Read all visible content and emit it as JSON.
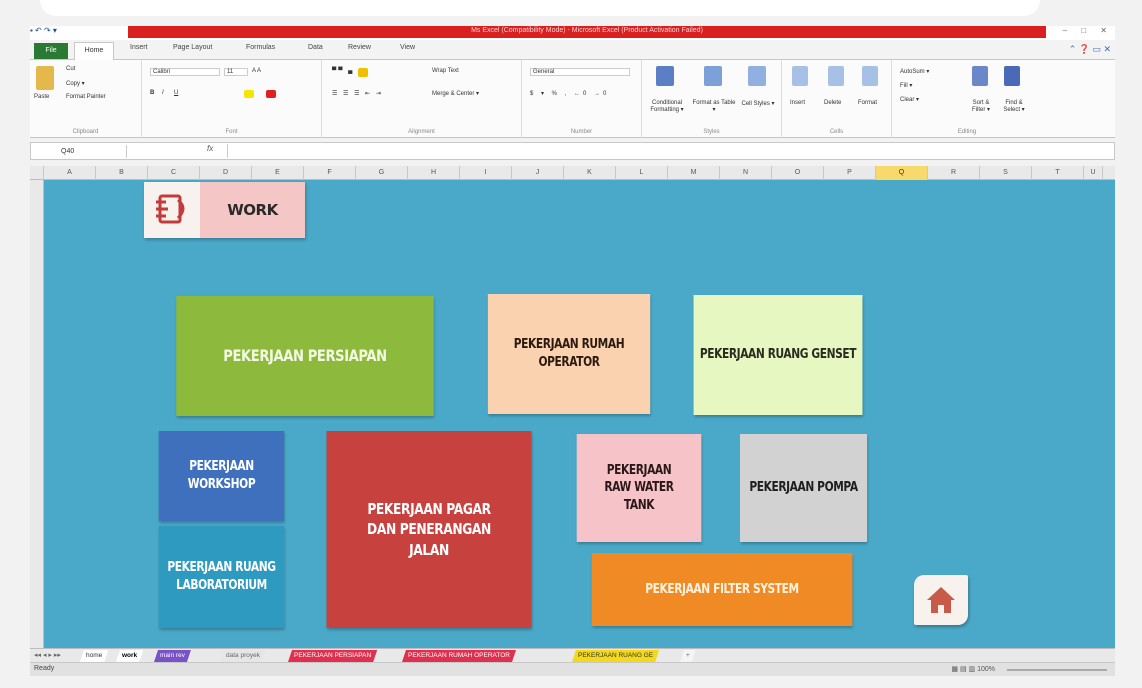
{
  "window": {
    "title": "Ms Excel (Compatibility Mode) - Microsoft Excel (Product Activation Failed)",
    "quick_access": "▪ ↶ ↷ ▾",
    "window_buttons": "– □ ✕"
  },
  "ribbon_tabs": {
    "file": "File",
    "home": "Home",
    "items": [
      "Insert",
      "Page Layout",
      "Formulas",
      "Data",
      "Review",
      "View"
    ]
  },
  "ribbon": {
    "clipboard": {
      "paste": "Paste",
      "cut": "Cut",
      "copy": "Copy ▾",
      "format_painter": "Format Painter",
      "label": "Clipboard"
    },
    "font": {
      "name": "Calibri",
      "size": "11",
      "label": "Font"
    },
    "alignment": {
      "wrap": "Wrap Text",
      "merge": "Merge & Center ▾",
      "label": "Alignment"
    },
    "number": {
      "format": "General",
      "label": "Number"
    },
    "styles": {
      "conditional": "Conditional Formatting ▾",
      "format_table": "Format as Table ▾",
      "cell_styles": "Cell Styles ▾",
      "label": "Styles"
    },
    "cells": {
      "insert": "Insert",
      "delete": "Delete",
      "format": "Format",
      "label": "Cells"
    },
    "editing": {
      "autosum": "AutoSum ▾",
      "fill": "Fill ▾",
      "clear": "Clear ▾",
      "sort": "Sort & Filter ▾",
      "find": "Find & Select ▾",
      "label": "Editing"
    }
  },
  "formula_bar": {
    "name_box": "Q40",
    "fx": "fx",
    "value": ""
  },
  "columns": [
    "A",
    "B",
    "C",
    "D",
    "E",
    "F",
    "G",
    "H",
    "I",
    "J",
    "K",
    "L",
    "M",
    "N",
    "O",
    "P",
    "Q",
    "R",
    "S",
    "T",
    "U"
  ],
  "selected_column": "Q",
  "header_tile": {
    "label": "WORK",
    "icon": "work-document-icon"
  },
  "tiles": [
    {
      "id": "persiapan",
      "label": "PEKERJAAN PERSIAPAN",
      "bg": "#8dba3c",
      "fg": "#f4f9e4"
    },
    {
      "id": "rumah-operator",
      "label": "PEKERJAAN RUMAH OPERATOR",
      "bg": "#fbd2b0",
      "fg": "#2a1a10"
    },
    {
      "id": "ruang-genset",
      "label": "PEKERJAAN RUANG GENSET",
      "bg": "#e6f7c2",
      "fg": "#2a2a20"
    },
    {
      "id": "workshop",
      "label": "PEKERJAAN WORKSHOP",
      "bg": "#3e70bd",
      "fg": "#ffffff"
    },
    {
      "id": "pagar",
      "label": "PEKERJAAN PAGAR DAN PENERANGAN JALAN",
      "bg": "#c7413e",
      "fg": "#ffffff"
    },
    {
      "id": "raw-water",
      "label": "PEKERJAAN RAW WATER TANK",
      "bg": "#f6c4c8",
      "fg": "#2a1818"
    },
    {
      "id": "pompa",
      "label": "PEKERJAAN POMPA",
      "bg": "#d2d2d2",
      "fg": "#1e1e1e"
    },
    {
      "id": "laboratorium",
      "label": "PEKERJAAN RUANG LABORATORIUM",
      "bg": "#2f9ac0",
      "fg": "#ffffff"
    },
    {
      "id": "filter",
      "label": "PEKERJAAN FILTER SYSTEM",
      "bg": "#f08a24",
      "fg": "#fff3e0"
    }
  ],
  "home_button": {
    "icon": "home-icon"
  },
  "sheet_tabs": [
    {
      "label": "home",
      "bg": "#ffffff",
      "fg": "#333333"
    },
    {
      "label": "work",
      "bg": "#ffffff",
      "fg": "#000000"
    },
    {
      "label": "main rev",
      "bg": "#7a52c8",
      "fg": "#ffffff"
    },
    {
      "label": "data proyek",
      "bg": "#e6e6e6",
      "fg": "#666666"
    },
    {
      "label": "PEKERJAAN PERSIAPAN",
      "bg": "#e03050",
      "fg": "#ffffff"
    },
    {
      "label": "PEKERJAAN RUMAH OPERATOR",
      "bg": "#e03050",
      "fg": "#ffffff"
    },
    {
      "label": "PEKERJAAN RUANG GE",
      "bg": "#f4d91a",
      "fg": "#333333"
    }
  ],
  "status": {
    "ready": "Ready",
    "views": "▦ ▤ ▥  100%"
  }
}
